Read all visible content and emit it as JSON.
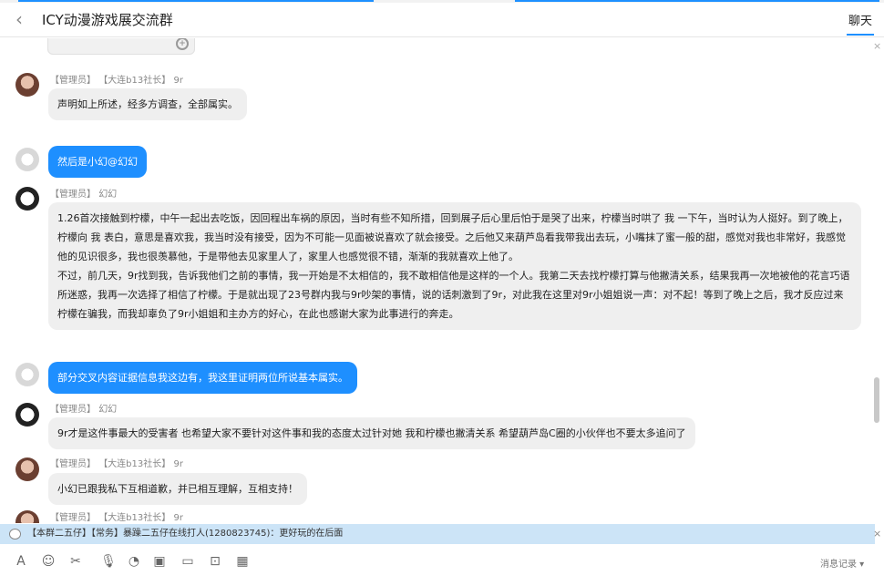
{
  "header": {
    "back_glyph": "‹",
    "title": "ICY动漫游戏展交流群",
    "tab_chat": "聊天"
  },
  "messages": [
    {
      "avatar": "admin-avatar",
      "role": "【管理员】",
      "sender": "【大连b13社长】",
      "sender_suffix": "9r",
      "text": "声明如上所述，经多方调查，全部属实。"
    },
    {
      "avatar": "cute-avatar",
      "text": "然后是小幻@幻幻"
    },
    {
      "avatar": "girl-avatar",
      "role": "【管理员】",
      "sender": "幻幻",
      "paragraph1": "1.26首次接触到柠檬，中午一起出去吃饭，因回程出车祸的原因，当时有些不知所措，回到展子后心里后怕于是哭了出来，柠檬当时哄了 我 一下午，当时认为人挺好。到了晚上，柠檬向 我 表白，意思是喜欢我，我当时没有接受，因为不可能一见面被说喜欢了就会接受。之后他又来葫芦岛看我带我出去玩，小嘴抹了蜜一般的甜，感觉对我也非常好，我感觉他的见识很多，我也很羡慕他，于是带他去见家里人了，家里人也感觉很不错，渐渐的我就喜欢上他了。",
      "paragraph2": "不过，前几天，9r找到我，告诉我他们之前的事情，我一开始是不太相信的，我不敢相信他是这样的一个人。我第二天去找柠檬打算与他撇清关系，结果我再一次地被他的花言巧语所迷惑，我再一次选择了相信了柠檬。于是就出现了23号群内我与9r吵架的事情，说的话刺激到了9r，对此我在这里对9r小姐姐说一声：对不起！等到了晚上之后，我才反应过来柠檬在骗我，而我却辜负了9r小姐姐和主办方的好心，在此也感谢大家为此事进行的奔走。"
    },
    {
      "avatar": "cute-avatar",
      "text": "部分交叉内容证据信息我这边有，我这里证明两位所说基本属实。"
    },
    {
      "avatar": "girl-avatar",
      "role": "【管理员】",
      "sender": "幻幻",
      "text": "9r才是这件事最大的受害者 也希望大家不要针对这件事和我的态度太过针对她 我和柠檬也撇清关系 希望葫芦岛C圈的小伙伴也不要太多追问了"
    },
    {
      "avatar": "admin-avatar",
      "role": "【管理员】",
      "sender": "【大连b13社长】",
      "sender_suffix": "9r",
      "text": "小幻已跟我私下互相道歉，并已相互理解，互相支持！"
    },
    {
      "avatar": "admin-avatar",
      "role": "【管理员】",
      "sender": "【大连b13社长】",
      "sender_suffix": "9r"
    }
  ],
  "notice": {
    "text": "【本群二五仔】【常务】暴躁二五仔在线打人(1280823745)：更好玩的在后面",
    "close_glyph": "×"
  },
  "toolbar": {
    "history_label": "消息记录 ▾",
    "icons": [
      "font-icon",
      "emoji-icon",
      "scissors-icon",
      "microphone-icon",
      "sticker-icon",
      "image-icon",
      "folder-icon",
      "screenshot-icon",
      "calendar-icon"
    ]
  },
  "colors": {
    "accent": "#1e8fff",
    "bubble_grey": "#efefef",
    "notice_bg": "#cce4f7"
  }
}
